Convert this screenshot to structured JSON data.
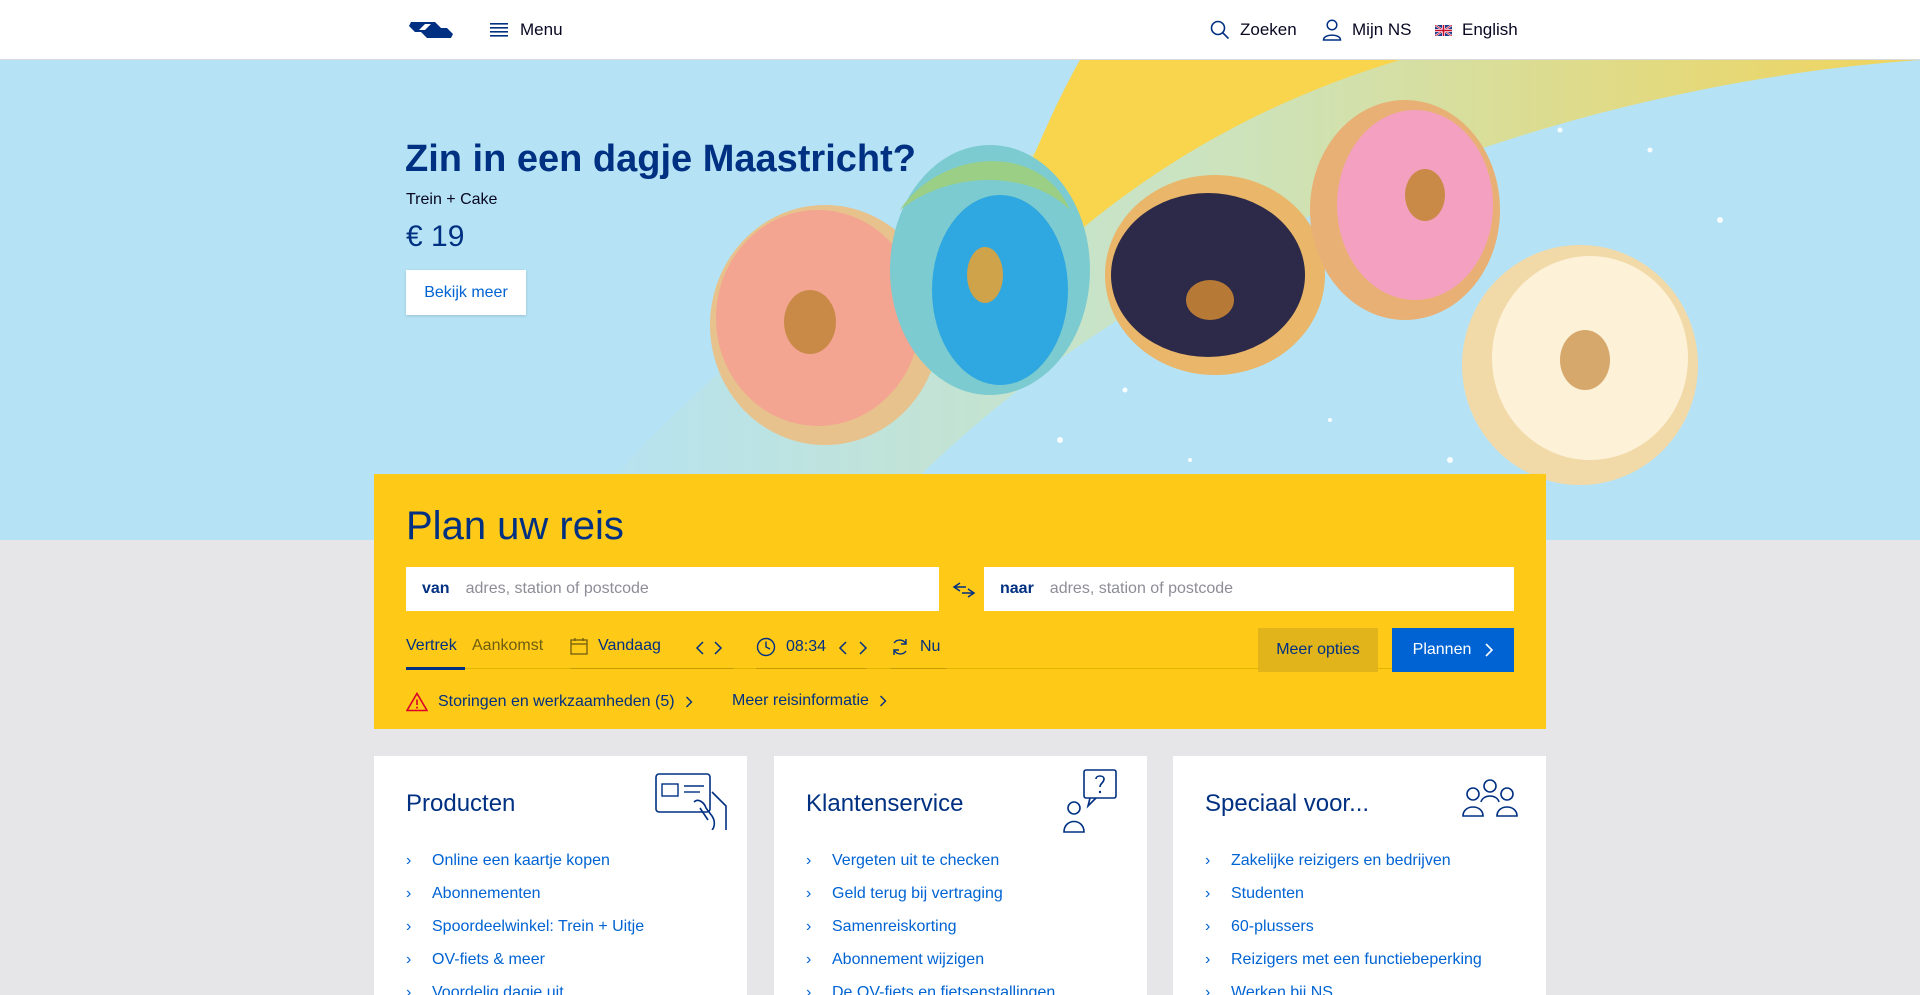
{
  "header": {
    "menu_label": "Menu",
    "search_label": "Zoeken",
    "account_label": "Mijn NS",
    "language_label": "English"
  },
  "hero": {
    "title": "Zin in een dagje Maastricht?",
    "subtitle": "Trein + Cake",
    "price": "€ 19",
    "cta_label": "Bekijk meer"
  },
  "planner": {
    "title": "Plan uw reis",
    "from_label": "van",
    "from_placeholder": "adres, station of postcode",
    "to_label": "naar",
    "to_placeholder": "adres, station of postcode",
    "tab_departure": "Vertrek",
    "tab_arrival": "Aankomst",
    "date_value": "Vandaag",
    "time_value": "08:34",
    "now_label": "Nu",
    "more_options_label": "Meer opties",
    "plan_label": "Plannen",
    "disruptions_label": "Storingen en werkzaamheden (5)",
    "more_info_label": "Meer reisinformatie"
  },
  "cards": [
    {
      "title": "Producten",
      "icon": "ticket-card-icon",
      "items": [
        "Online een kaartje kopen",
        "Abonnementen",
        "Spoordeelwinkel: Trein + Uitje",
        "OV-fiets & meer",
        "Voordelig dagje uit"
      ]
    },
    {
      "title": "Klantenservice",
      "icon": "customer-question-icon",
      "items": [
        "Vergeten uit te checken",
        "Geld terug bij vertraging",
        "Samenreiskorting",
        "Abonnement wijzigen",
        "De OV-fiets en fietsenstallingen"
      ]
    },
    {
      "title": "Speciaal voor...",
      "icon": "group-people-icon",
      "items": [
        "Zakelijke reizigers en bedrijven",
        "Studenten",
        "60-plussers",
        "Reizigers met een functiebeperking",
        "Werken bij NS"
      ]
    }
  ],
  "colors": {
    "brand_blue": "#003082",
    "link_blue": "#0063d3",
    "brand_yellow": "#ffc917",
    "hero_sky": "#b5e3f5",
    "page_gray": "#e6e6e9"
  }
}
